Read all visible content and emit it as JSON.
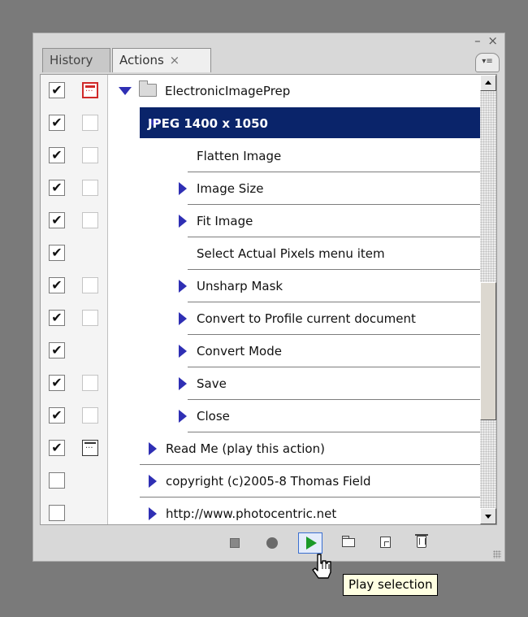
{
  "window": {
    "controls": "– ×"
  },
  "tabs": [
    {
      "label": "History"
    },
    {
      "label": "Actions",
      "close": "×"
    }
  ],
  "flyout_icon": "panel-menu-icon",
  "rows": [
    {
      "label": "ElectronicImagePrep",
      "checked": true,
      "dialog": "red",
      "indent": 0,
      "expander": "expanded",
      "type": "action-set"
    },
    {
      "label": "JPEG 1400 x 1050",
      "checked": true,
      "dialog": "empty",
      "indent": 1,
      "expander": "expanded",
      "selected": true,
      "type": "action"
    },
    {
      "label": "Flatten Image",
      "checked": true,
      "dialog": "empty",
      "indent": 2,
      "expander": "none",
      "type": "step"
    },
    {
      "label": "Image Size",
      "checked": true,
      "dialog": "empty",
      "indent": 2,
      "expander": "collapsed",
      "type": "step"
    },
    {
      "label": "Fit Image",
      "checked": true,
      "dialog": "empty",
      "indent": 2,
      "expander": "collapsed",
      "type": "step"
    },
    {
      "label": "Select Actual Pixels menu item",
      "checked": true,
      "dialog": "none",
      "indent": 2,
      "expander": "none",
      "type": "step"
    },
    {
      "label": "Unsharp Mask",
      "checked": true,
      "dialog": "empty",
      "indent": 2,
      "expander": "collapsed",
      "type": "step"
    },
    {
      "label": "Convert to Profile current document",
      "checked": true,
      "dialog": "empty",
      "indent": 2,
      "expander": "collapsed",
      "type": "step"
    },
    {
      "label": "Convert Mode",
      "checked": true,
      "dialog": "none",
      "indent": 2,
      "expander": "collapsed",
      "type": "step"
    },
    {
      "label": "Save",
      "checked": true,
      "dialog": "empty",
      "indent": 2,
      "expander": "collapsed",
      "type": "step"
    },
    {
      "label": "Close",
      "checked": true,
      "dialog": "empty",
      "indent": 2,
      "expander": "collapsed",
      "type": "step"
    },
    {
      "label": "Read Me (play this action)",
      "checked": true,
      "dialog": "dark",
      "indent": 1,
      "expander": "collapsed",
      "type": "action"
    },
    {
      "label": "copyright (c)2005-8 Thomas Field",
      "checked": false,
      "dialog": "none",
      "indent": 1,
      "expander": "collapsed",
      "type": "action"
    },
    {
      "label": "http://www.photocentric.net",
      "checked": false,
      "dialog": "none",
      "indent": 1,
      "expander": "collapsed",
      "type": "action"
    }
  ],
  "toolbar": [
    {
      "name": "stop-playing-icon"
    },
    {
      "name": "begin-recording-icon"
    },
    {
      "name": "play-selection-icon",
      "active": true
    },
    {
      "name": "create-new-set-icon"
    },
    {
      "name": "create-new-action-icon"
    },
    {
      "name": "delete-icon"
    }
  ],
  "tooltip": "Play selection",
  "colors": {
    "selection": "#0a246a",
    "triangle": "#2f2fb4",
    "play": "#1a9a2a",
    "tooltip_bg": "#ffffe1"
  }
}
